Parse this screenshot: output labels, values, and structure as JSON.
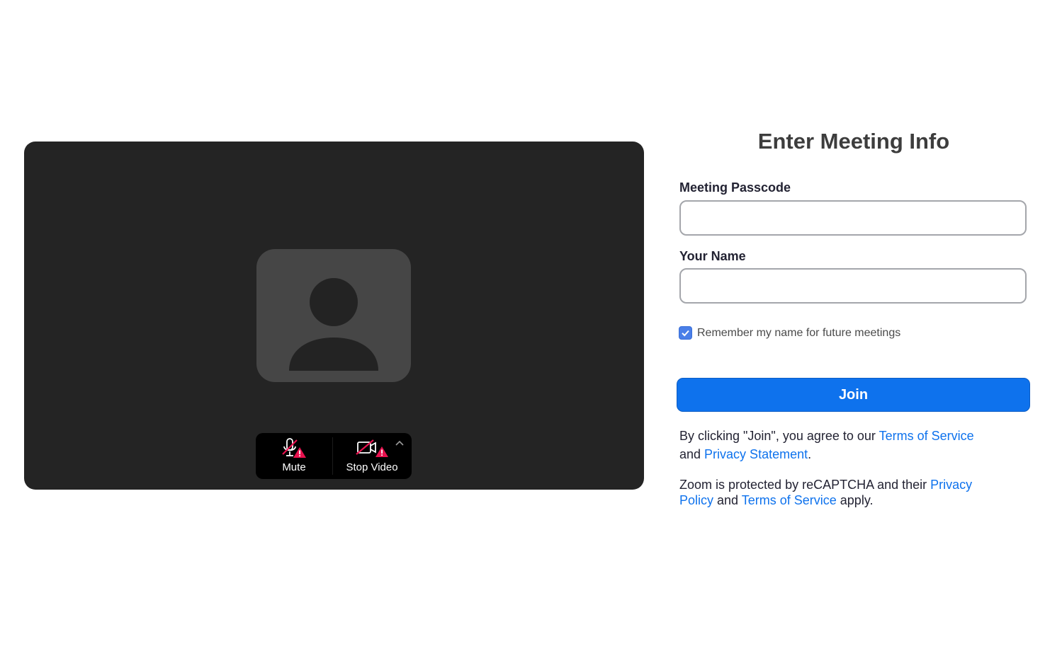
{
  "preview": {
    "mute_label": "Mute",
    "video_label": "Stop Video"
  },
  "icons": {
    "avatar": "person-placeholder-icon",
    "mute": "microphone-off-warning-icon",
    "video": "camera-off-warning-icon",
    "caret": "chevron-up-icon",
    "check": "check-icon"
  },
  "form": {
    "title": "Enter Meeting Info",
    "passcode_label": "Meeting Passcode",
    "passcode_value": "",
    "name_label": "Your Name",
    "name_value": "",
    "remember_label": "Remember my name for future meetings",
    "remember_checked": true,
    "join_label": "Join"
  },
  "legal": {
    "agree_prefix": "By clicking \"Join\", you agree to our ",
    "terms_link": "Terms of Service",
    "agree_and": " and ",
    "privacy_statement_link": "Privacy Statement",
    "agree_suffix": ".",
    "recaptcha_prefix": "Zoom is protected by reCAPTCHA and their ",
    "privacy_policy_link": "Privacy Policy",
    "recaptcha_and": " and ",
    "recaptcha_terms_link": "Terms of Service",
    "recaptcha_suffix": " apply."
  },
  "colors": {
    "accent": "#0e72ed",
    "preview_bg": "#242424",
    "avatar_bg": "#464646",
    "warning": "#e8124f"
  }
}
